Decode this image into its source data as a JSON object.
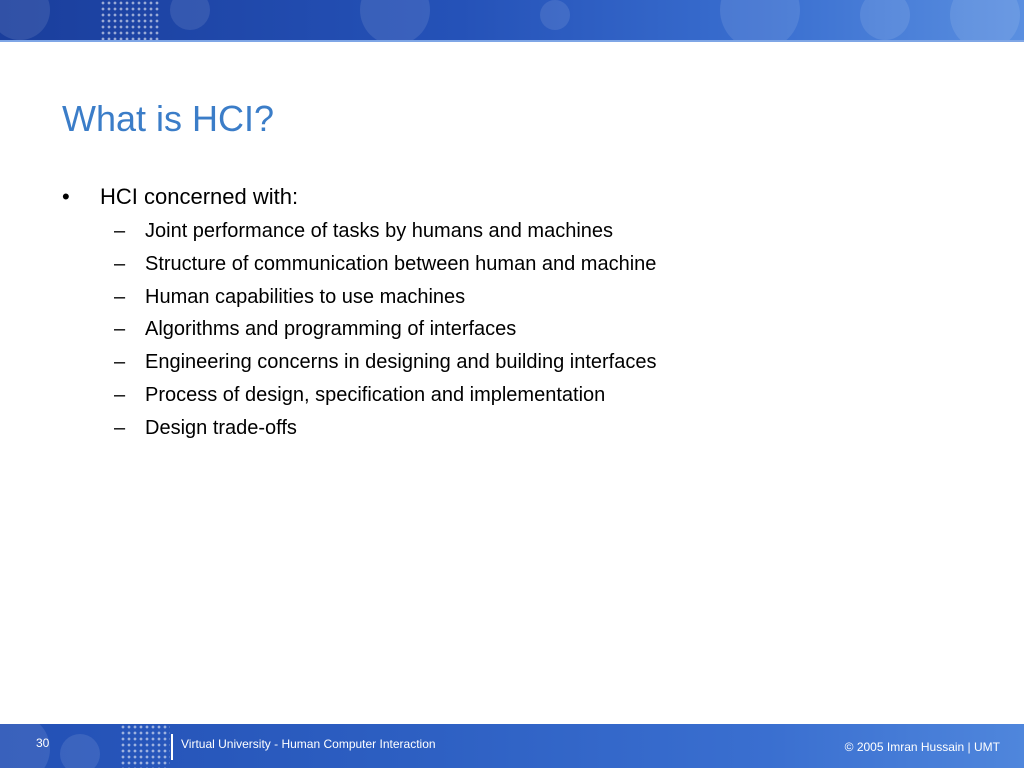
{
  "slide": {
    "title": "What is HCI?",
    "bullet": {
      "marker": "•",
      "text": "HCI concerned with:",
      "sub_marker": "–",
      "subitems": [
        "Joint performance of tasks by humans and machines",
        "Structure of communication between human and machine",
        "Human capabilities to use machines",
        "Algorithms and programming of interfaces",
        "Engineering concerns in designing and building interfaces",
        "Process of design, specification and implementation",
        "Design trade-offs"
      ]
    }
  },
  "footer": {
    "page_number": "30",
    "course": "Virtual University - Human Computer Interaction",
    "copyright": "© 2005 Imran Hussain | UMT"
  },
  "colors": {
    "title": "#3b7dc8",
    "band_dark": "#1a3e9c",
    "band_light": "#5a8fe0",
    "text": "#000000"
  }
}
